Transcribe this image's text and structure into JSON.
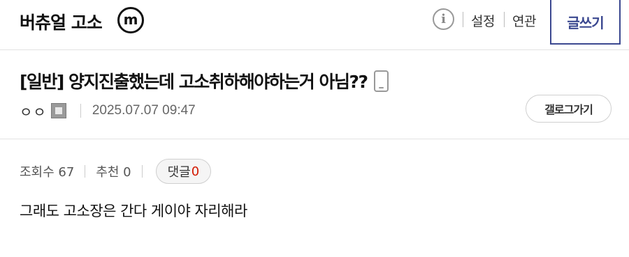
{
  "header": {
    "gallery_title": "버츄얼 고소",
    "badge_letter": "m",
    "info_icon": "i",
    "settings_label": "설정",
    "related_label": "연관",
    "write_label": "글쓰기",
    "accent_color": "#3b4890"
  },
  "post": {
    "title": "[일반] 양지진출했는데 고소취하해야하는거 아님??",
    "author": "ㅇㅇ",
    "date": "2025.07.07 09:47",
    "gallery_button_label": "갤로그가기",
    "views_text": "조회수 67",
    "recommend_text": "추천 0",
    "comment_label": "댓글",
    "comment_count": "0",
    "comment_count_color": "#d31900",
    "body": "그래도 고소장은 간다 게이야 자리해라"
  }
}
